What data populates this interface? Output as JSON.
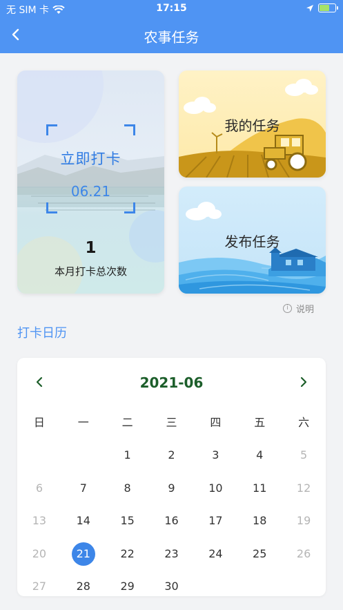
{
  "status": {
    "carrier": "无 SIM 卡",
    "time": "17:15"
  },
  "nav": {
    "title": "农事任务"
  },
  "checkin": {
    "label": "立即打卡",
    "date": "06.21",
    "count": "1",
    "count_label": "本月打卡总次数"
  },
  "tasks": {
    "my_task": "我的任务",
    "publish_task": "发布任务"
  },
  "info_label": "说明",
  "calendar": {
    "section_title": "打卡日历",
    "month": "2021-06",
    "weekdays": [
      "日",
      "一",
      "二",
      "三",
      "四",
      "五",
      "六"
    ],
    "weeks": [
      [
        "",
        "",
        "1",
        "2",
        "3",
        "4",
        "5"
      ],
      [
        "6",
        "7",
        "8",
        "9",
        "10",
        "11",
        "12"
      ],
      [
        "13",
        "14",
        "15",
        "16",
        "17",
        "18",
        "19"
      ],
      [
        "20",
        "21",
        "22",
        "23",
        "24",
        "25",
        "26"
      ],
      [
        "27",
        "28",
        "29",
        "30",
        "",
        "",
        ""
      ]
    ],
    "selected_day": "21"
  },
  "colors": {
    "brand": "#4f94f3",
    "accent": "#3d86e8",
    "month_text": "#1c5e2a"
  }
}
